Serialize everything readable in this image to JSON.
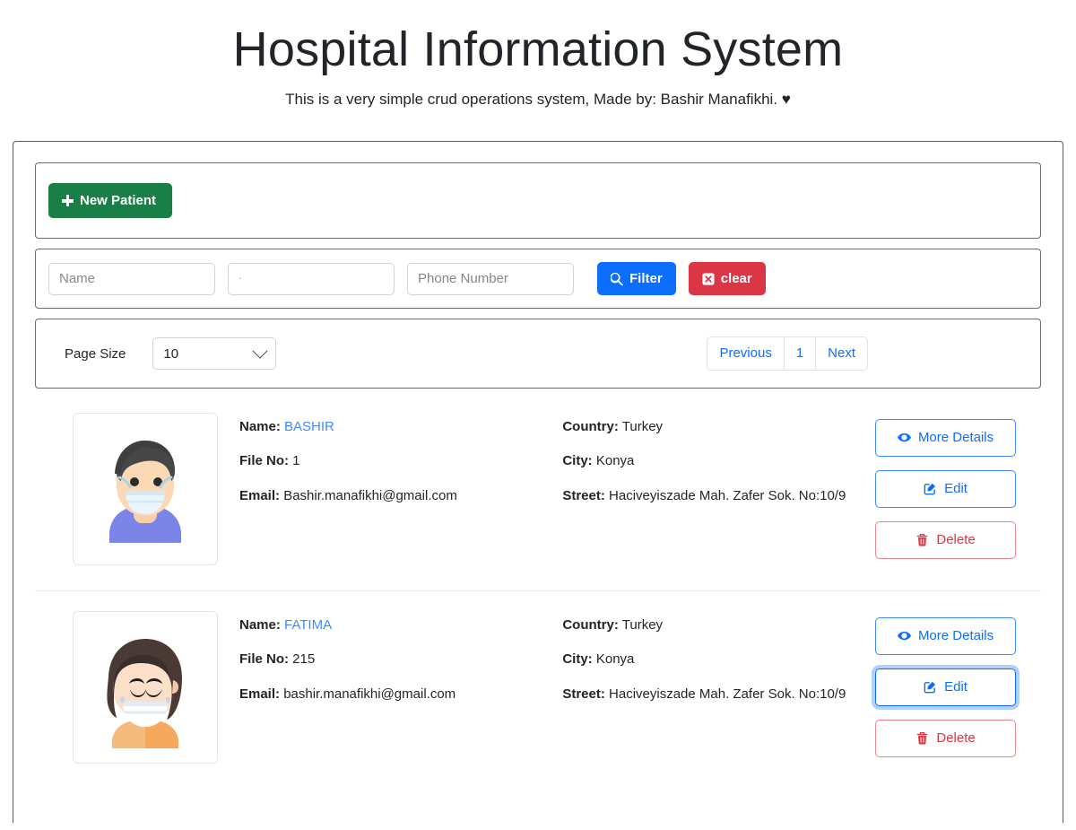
{
  "header": {
    "title": "Hospital Information System",
    "subtitle": "This is a very simple crud operations system, Made by: Bashir Manafikhi.",
    "heart": "♥"
  },
  "toolbar": {
    "new_patient_label": "New Patient",
    "new_patient_icon": "plus-icon"
  },
  "filter": {
    "name_placeholder": "Name",
    "name_value": "",
    "second_placeholder": "·",
    "second_value": "",
    "phone_placeholder": "Phone Number",
    "phone_value": "",
    "filter_label": "Filter",
    "filter_icon": "search-icon",
    "clear_label": "clear",
    "clear_icon": "x-square-icon"
  },
  "paging": {
    "page_size_label": "Page Size",
    "page_size_value": "10",
    "page_size_options": [
      "10"
    ],
    "previous_label": "Previous",
    "current_page": "1",
    "next_label": "Next"
  },
  "labels": {
    "name": "Name:",
    "file_no": "File No:",
    "email": "Email:",
    "country": "Country:",
    "city": "City:",
    "street": "Street:",
    "more_details": "More Details",
    "edit": "Edit",
    "delete": "Delete"
  },
  "icons": {
    "more_details": "eye-icon",
    "edit": "pencil-square-icon",
    "delete": "trash-icon"
  },
  "colors": {
    "green": "#1a7f46",
    "blue": "#0d6efd",
    "red": "#dc3545",
    "link": "#3d8bfd"
  },
  "patients": [
    {
      "avatar": "male-masked-avatar",
      "name": "BASHIR",
      "file_no": "1",
      "email": "Bashir.manafikhi@gmail.com",
      "country": "Turkey",
      "city": "Konya",
      "street": "Haciveyiszade Mah. Zafer Sok. No:10/9",
      "edit_focused": false
    },
    {
      "avatar": "female-masked-avatar",
      "name": "FATIMA",
      "file_no": "215",
      "email": "bashir.manafikhi@gmail.com",
      "country": "Turkey",
      "city": "Konya",
      "street": "Haciveyiszade Mah. Zafer Sok. No:10/9",
      "edit_focused": true
    }
  ]
}
